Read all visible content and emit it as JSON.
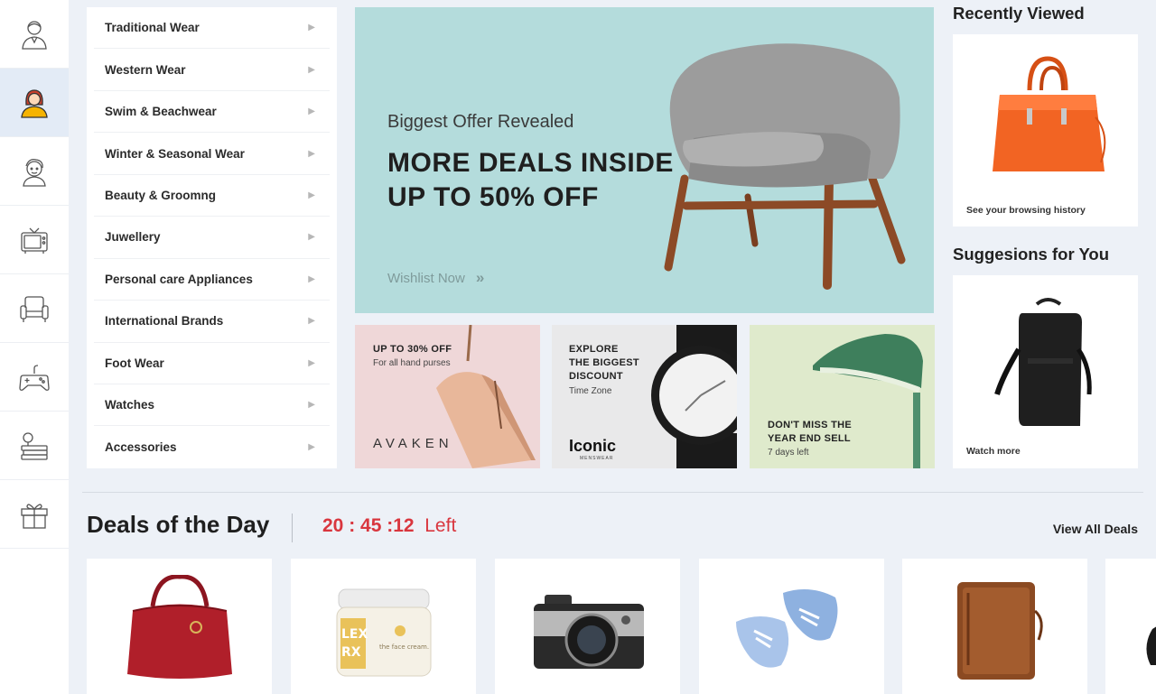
{
  "rail": {
    "items": [
      {
        "icon": "man-avatar-icon"
      },
      {
        "icon": "woman-avatar-icon"
      },
      {
        "icon": "child-avatar-icon"
      },
      {
        "icon": "tv-icon"
      },
      {
        "icon": "armchair-icon"
      },
      {
        "icon": "gamepad-icon"
      },
      {
        "icon": "books-icon"
      },
      {
        "icon": "gift-icon"
      }
    ],
    "active_index": 1,
    "active_color": "#f5b301"
  },
  "menu": {
    "items": [
      {
        "label": "Traditional Wear"
      },
      {
        "label": "Western Wear"
      },
      {
        "label": "Swim & Beachwear"
      },
      {
        "label": "Winter & Seasonal Wear"
      },
      {
        "label": "Beauty & Groomng"
      },
      {
        "label": "Juwellery"
      },
      {
        "label": "Personal care Appliances"
      },
      {
        "label": "International Brands"
      },
      {
        "label": "Foot Wear"
      },
      {
        "label": "Watches"
      },
      {
        "label": "Accessories"
      }
    ]
  },
  "hero": {
    "subtitle": "Biggest Offer Revealed",
    "title_line1": "MORE DEALS INSIDE",
    "title_line2": "UP TO 50% OFF",
    "link": "Wishlist Now",
    "bg_color": "#b4dcdc"
  },
  "tiles": [
    {
      "line1": "UP TO 30% OFF",
      "sub": "For all hand purses",
      "brand": "AVAKEN"
    },
    {
      "line1": "EXPLORE",
      "line2": "THE BIGGEST",
      "line3": "DISCOUNT",
      "sub": "Time Zone",
      "brand": "Iconic",
      "brand_sub": "MENSWEAR"
    },
    {
      "line1": "DON'T MISS THE",
      "line2": "YEAR END SELL",
      "sub": "7 days left"
    }
  ],
  "recent": {
    "title": "Recently Viewed",
    "caption": "See your browsing history"
  },
  "suggest": {
    "title": "Suggesions for You",
    "caption": "Watch more"
  },
  "deals": {
    "title": "Deals of the Day",
    "timer": "20 : 45 :12",
    "timer_suffix": "Left",
    "view_all": "View All Deals",
    "accent": "#d9363e",
    "jar_label1": "LEX",
    "jar_label2": "RX",
    "jar_brand": "the face cream."
  }
}
